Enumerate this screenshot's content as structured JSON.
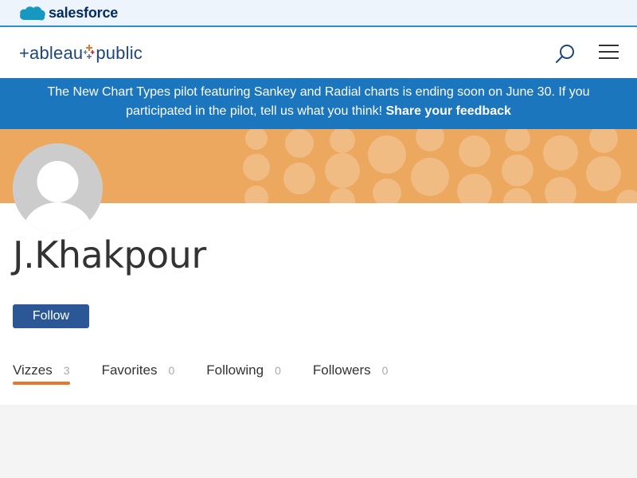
{
  "salesforce": {
    "brand": "salesforce"
  },
  "header": {
    "brand_part1": "+ableau",
    "brand_part2": "public",
    "search_icon": "search-icon",
    "menu_icon": "menu-icon"
  },
  "banner": {
    "line1": "The New Chart Types pilot featuring Sankey and Radial charts is ending soon on June 30. If you",
    "line2": "participated in the pilot, tell us what you think!",
    "link": "Share your feedback"
  },
  "profile": {
    "name": "J.Khakpour",
    "follow_label": "Follow",
    "avatar_icon": "user-placeholder-icon",
    "tabs": [
      {
        "label": "Vizzes",
        "count": "3"
      },
      {
        "label": "Favorites",
        "count": "0"
      },
      {
        "label": "Following",
        "count": "0"
      },
      {
        "label": "Followers",
        "count": "0"
      }
    ]
  },
  "colors": {
    "salesforce_accent": "#2a8fd4",
    "banner": "#1b76be",
    "cover": "#eca85e",
    "follow_button": "#2b5797",
    "active_tab_underline": "#e8762d"
  }
}
